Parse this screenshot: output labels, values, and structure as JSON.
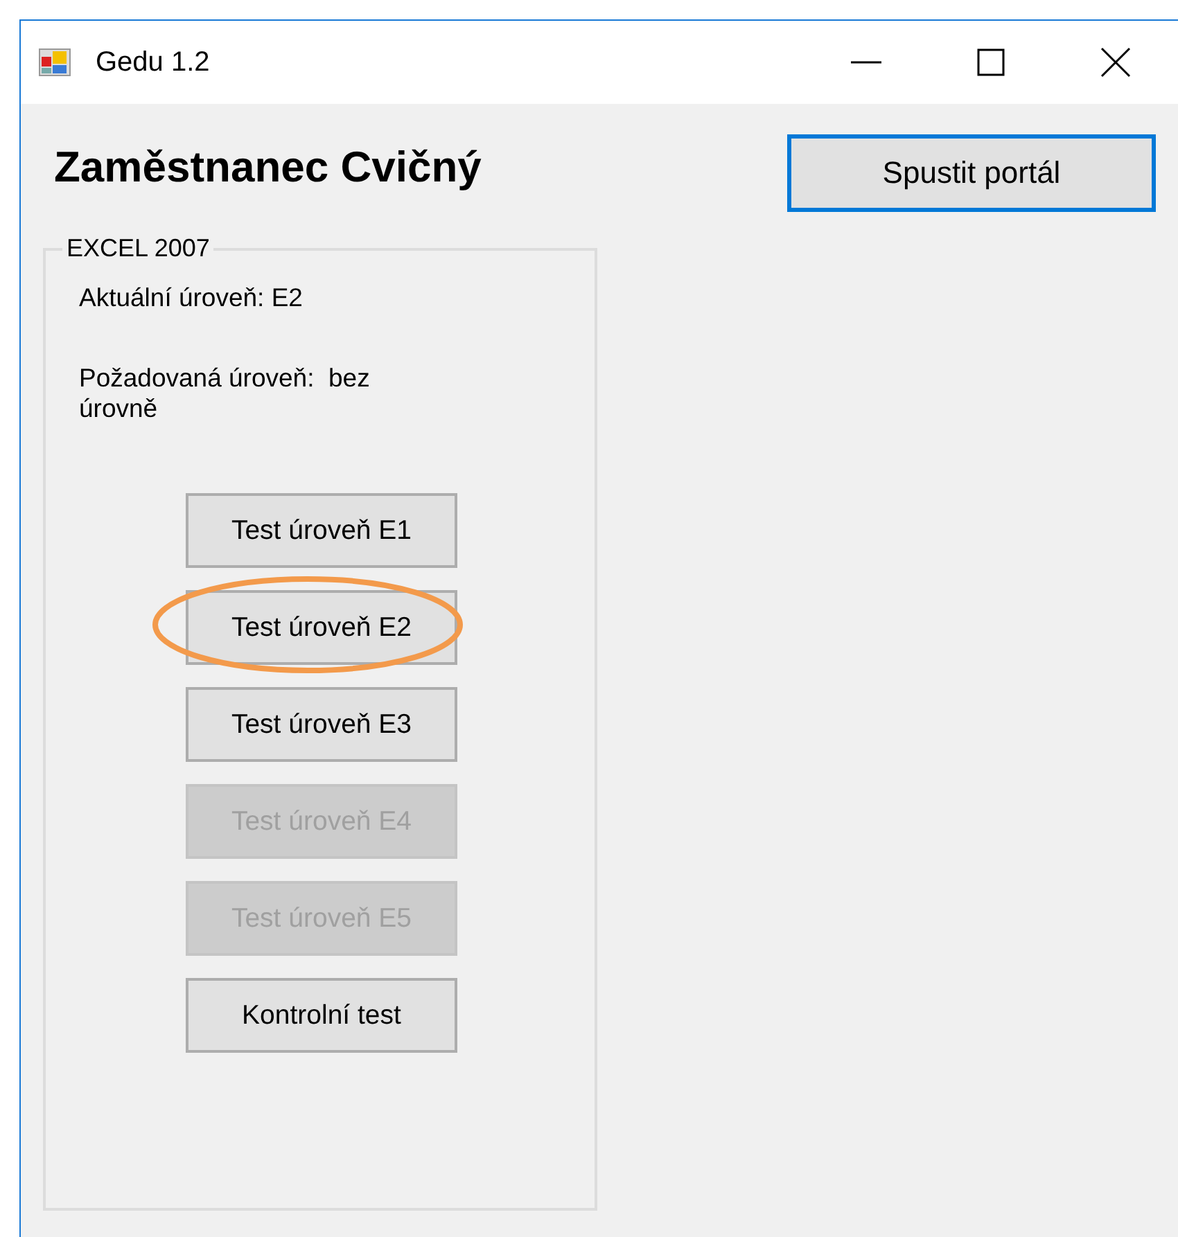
{
  "window": {
    "title": "Gedu 1.2"
  },
  "heading": "Zaměstnanec Cvičný",
  "portal_button": {
    "label": "Spustit portál",
    "focused": true
  },
  "group": {
    "title": "EXCEL 2007",
    "labels": [
      "Aktuální úroveň: E2",
      "Požadovaná úroveň:  bez úrovně"
    ],
    "buttons": [
      {
        "label": "Test úroveň E1",
        "disabled": false,
        "highlighted": false
      },
      {
        "label": "Test úroveň E2",
        "disabled": false,
        "highlighted": true
      },
      {
        "label": "Test úroveň E3",
        "disabled": false,
        "highlighted": false
      },
      {
        "label": "Test úroveň E4",
        "disabled": true,
        "highlighted": false
      },
      {
        "label": "Test úroveň E5",
        "disabled": true,
        "highlighted": false
      },
      {
        "label": "Kontrolní test",
        "disabled": false,
        "highlighted": false
      }
    ]
  }
}
